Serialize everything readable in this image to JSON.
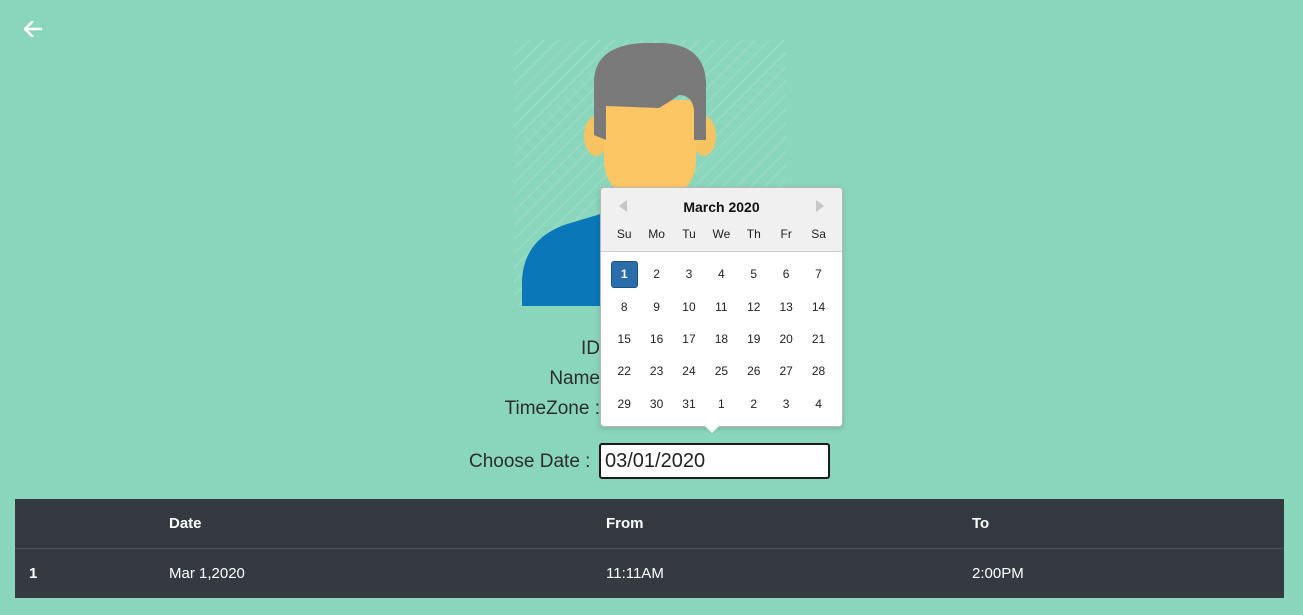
{
  "profile": {
    "id_label": "ID",
    "name_label": "Name",
    "timezone_label": "TimeZone :"
  },
  "date_picker": {
    "label": "Choose Date :",
    "value": "03/01/2020",
    "month_title": "March 2020",
    "weekdays": [
      "Su",
      "Mo",
      "Tu",
      "We",
      "Th",
      "Fr",
      "Sa"
    ],
    "weeks": [
      [
        "1",
        "2",
        "3",
        "4",
        "5",
        "6",
        "7"
      ],
      [
        "8",
        "9",
        "10",
        "11",
        "12",
        "13",
        "14"
      ],
      [
        "15",
        "16",
        "17",
        "18",
        "19",
        "20",
        "21"
      ],
      [
        "22",
        "23",
        "24",
        "25",
        "26",
        "27",
        "28"
      ],
      [
        "29",
        "30",
        "31",
        "1",
        "2",
        "3",
        "4"
      ]
    ],
    "selected_day": "1"
  },
  "table": {
    "headers": [
      "",
      "Date",
      "From",
      "To"
    ],
    "rows": [
      [
        "1",
        "Mar 1,2020",
        "11:11AM",
        "2:00PM"
      ]
    ]
  },
  "colors": {
    "background": "#8ad6bc",
    "table_bg": "#343a40",
    "selected_day": "#2b6cab"
  }
}
